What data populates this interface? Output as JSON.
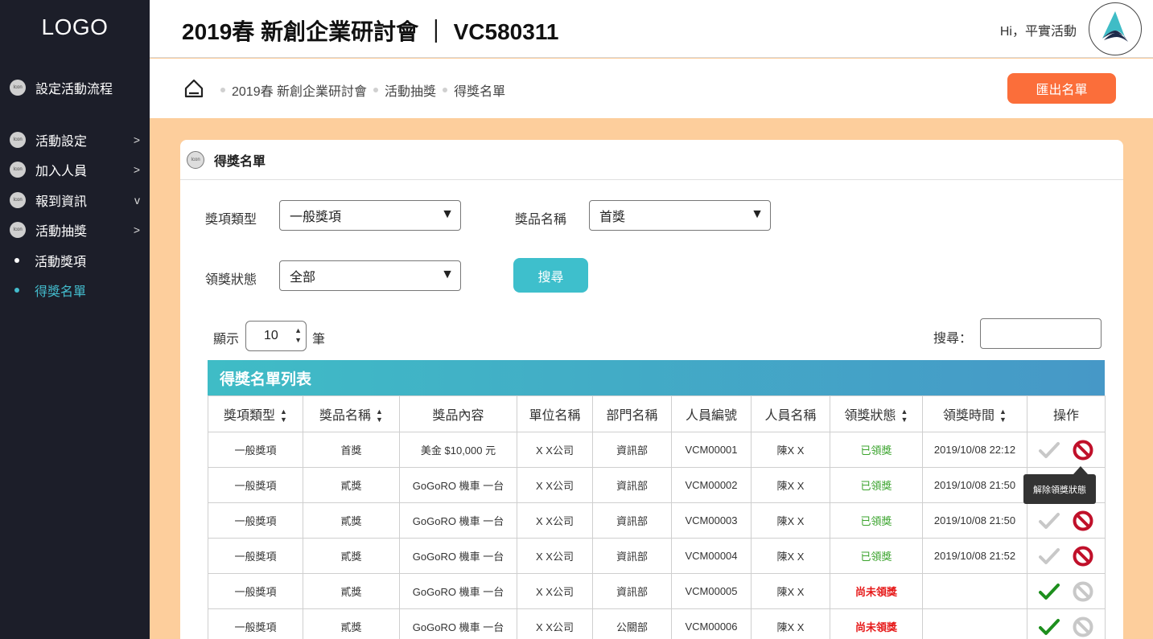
{
  "sidebar": {
    "logo": "LOGO",
    "icon_text": "Icon",
    "items": [
      {
        "label": "設定活動流程",
        "chevron": ""
      },
      {
        "label": "活動設定",
        "chevron": ">"
      },
      {
        "label": "加入人員",
        "chevron": ">"
      },
      {
        "label": "報到資訊",
        "chevron": "v"
      },
      {
        "label": "活動抽獎",
        "chevron": ">"
      }
    ],
    "subitems": [
      {
        "label": "活動獎項",
        "active": false
      },
      {
        "label": "得獎名單",
        "active": true
      }
    ]
  },
  "header": {
    "title": "2019春 新創企業研討會 ｜ VC580311",
    "greeting": "Hi，平實活動"
  },
  "breadcrumb": {
    "items": [
      "2019春 新創企業研討會",
      "活動抽獎",
      "得獎名單"
    ]
  },
  "export_button": "匯出名單",
  "card": {
    "icon_text": "Icon",
    "title": "得獎名單"
  },
  "filters": {
    "award_type_label": "獎項類型",
    "award_type_value": "一般獎項",
    "prize_name_label": "獎品名稱",
    "prize_name_value": "首獎",
    "claim_status_label": "領獎狀態",
    "claim_status_value": "全部",
    "search_button": "搜尋",
    "dropdown_arrow": "▼"
  },
  "pagination": {
    "show_label": "顯示",
    "page_size": "10",
    "unit_label": "筆",
    "search_label": "搜尋："
  },
  "table": {
    "title": "得獎名單列表",
    "columns": [
      "獎項類型",
      "獎品名稱",
      "獎品內容",
      "單位名稱",
      "部門名稱",
      "人員編號",
      "人員名稱",
      "領獎狀態",
      "領獎時間",
      "操作"
    ],
    "sortable": [
      true,
      true,
      false,
      false,
      false,
      false,
      false,
      true,
      true,
      false
    ],
    "rows": [
      {
        "award_type": "一般獎項",
        "prize": "首獎",
        "content": "美金 $10,000 元",
        "unit": "X X公司",
        "dept": "資訊部",
        "staff_id": "VCM00001",
        "name": "陳X X",
        "status": "已領獎",
        "claimed": true,
        "time": "2019/10/08 22:12"
      },
      {
        "award_type": "一般獎項",
        "prize": "貳獎",
        "content": "GoGoRO 機車 一台",
        "unit": "X X公司",
        "dept": "資訊部",
        "staff_id": "VCM00002",
        "name": "陳X X",
        "status": "已領獎",
        "claimed": true,
        "time": "2019/10/08 21:50"
      },
      {
        "award_type": "一般獎項",
        "prize": "貳獎",
        "content": "GoGoRO 機車 一台",
        "unit": "X X公司",
        "dept": "資訊部",
        "staff_id": "VCM00003",
        "name": "陳X X",
        "status": "已領獎",
        "claimed": true,
        "time": "2019/10/08 21:50"
      },
      {
        "award_type": "一般獎項",
        "prize": "貳獎",
        "content": "GoGoRO 機車 一台",
        "unit": "X X公司",
        "dept": "資訊部",
        "staff_id": "VCM00004",
        "name": "陳X X",
        "status": "已領獎",
        "claimed": true,
        "time": "2019/10/08 21:52"
      },
      {
        "award_type": "一般獎項",
        "prize": "貳獎",
        "content": "GoGoRO 機車 一台",
        "unit": "X X公司",
        "dept": "資訊部",
        "staff_id": "VCM00005",
        "name": "陳X X",
        "status": "尚未領獎",
        "claimed": false,
        "time": ""
      },
      {
        "award_type": "一般獎項",
        "prize": "貳獎",
        "content": "GoGoRO 機車 一台",
        "unit": "X X公司",
        "dept": "公關部",
        "staff_id": "VCM00006",
        "name": "陳X X",
        "status": "尚未領獎",
        "claimed": false,
        "time": ""
      }
    ]
  },
  "tooltip": "解除領獎狀態",
  "colors": {
    "sidebar_bg": "#1c1e29",
    "active_accent": "#43bccd",
    "export_btn": "#fb6e3a",
    "page_bg": "#fdce9c",
    "claimed_green": "#3aa32c",
    "unclaimed_red": "#e61717",
    "cancel_red": "#c0102a"
  }
}
